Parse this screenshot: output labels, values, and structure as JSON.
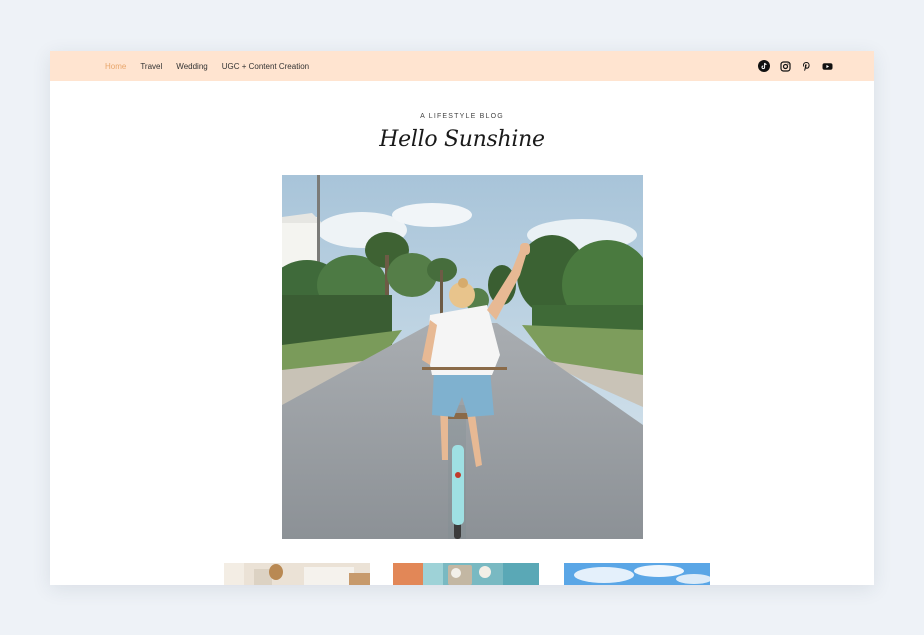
{
  "nav": {
    "items": [
      {
        "label": "Home",
        "active": true
      },
      {
        "label": "Travel",
        "active": false
      },
      {
        "label": "Wedding",
        "active": false
      },
      {
        "label": "UGC + Content Creation",
        "active": false
      }
    ]
  },
  "social": [
    "tiktok-icon",
    "instagram-icon",
    "pinterest-icon",
    "youtube-icon"
  ],
  "header": {
    "kicker": "A LIFESTYLE BLOG",
    "title": "Hello Sunshine"
  },
  "colors": {
    "topbar": "#ffe4d0",
    "active_nav": "#e8a66b",
    "page_bg": "#eef2f7"
  }
}
